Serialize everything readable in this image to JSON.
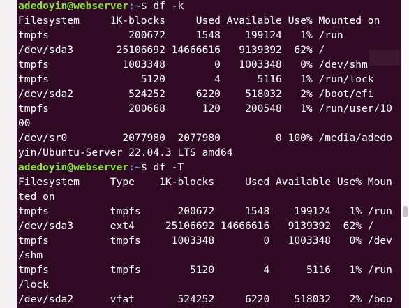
{
  "prompt": {
    "user_host": "adedoyin@webserver",
    "path": ":~",
    "symbol": "$"
  },
  "commands": [
    "df -k",
    "df -T"
  ],
  "output_lines": [
    "Filesystem     1K-blocks     Used Available Use% Mounted on",
    "tmpfs             200672     1548    199124   1% /run",
    "/dev/sda3       25106692 14666616   9139392  62% /",
    "tmpfs            1003348        0   1003348   0% /dev/shm",
    "tmpfs               5120        4      5116   1% /run/lock",
    "/dev/sda2         524252     6220    518032   2% /boot/efi",
    "tmpfs             200668      120    200548   1% /run/user/10",
    "00",
    "/dev/sr0         2077980  2077980         0 100% /media/adedo",
    "yin/Ubuntu-Server 22.04.3 LTS amd64",
    "Filesystem     Type    1K-blocks     Used Available Use% Moun",
    "ted on",
    "tmpfs          tmpfs      200672     1548    199124   1% /run",
    "/dev/sda3      ext4     25106692 14666616   9139392  62% /",
    "tmpfs          tmpfs     1003348        0   1003348   0% /dev",
    "/shm",
    "tmpfs          tmpfs        5120        4      5116   1% /run",
    "/lock",
    "/dev/sda2      vfat       524252     6220    518032   2% /boo"
  ],
  "colors": {
    "background": "#300a24",
    "foreground": "#ffffff",
    "prompt_user": "#8ae234",
    "prompt_path": "#729fcf"
  }
}
